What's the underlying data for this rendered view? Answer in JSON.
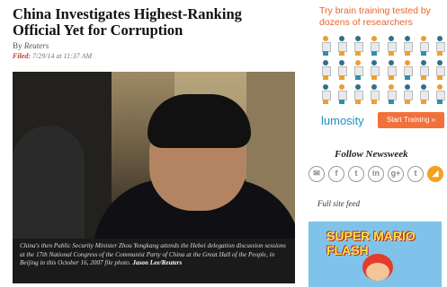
{
  "article": {
    "headline": "China Investigates Highest-Ranking Official Yet for Corruption",
    "byline_prefix": "By",
    "author": "Reuters",
    "filed_label": "Filed:",
    "filed_time": "7/29/14 at 11:37 AM",
    "caption": "China's then Public Security Minister Zhou Yongkang attends the Hebei delegation discussion sessions at the 17th National Congress of the Communist Party of China at the Great Hall of the People, in Beijing in this October 16, 2007 file photo.",
    "caption_credit": "Jason Lee/Reuters"
  },
  "ad_lumosity": {
    "title": "Try brain training tested by dozens of researchers",
    "logo": "lumosity",
    "button": "Start Training »",
    "accent": "#f2713b"
  },
  "sidebar": {
    "follow_title": "Follow Newsweek",
    "social_icons": [
      {
        "name": "email-icon",
        "glyph": "✉"
      },
      {
        "name": "facebook-icon",
        "glyph": "f"
      },
      {
        "name": "twitter-icon",
        "glyph": "t"
      },
      {
        "name": "linkedin-icon",
        "glyph": "in"
      },
      {
        "name": "googleplus-icon",
        "glyph": "g+"
      },
      {
        "name": "tumblr-icon",
        "glyph": "t"
      },
      {
        "name": "rss-icon",
        "glyph": "◢"
      }
    ],
    "full_feed": "Full site feed"
  },
  "ad_mario": {
    "title": "SUPER MARIO FLASH"
  }
}
